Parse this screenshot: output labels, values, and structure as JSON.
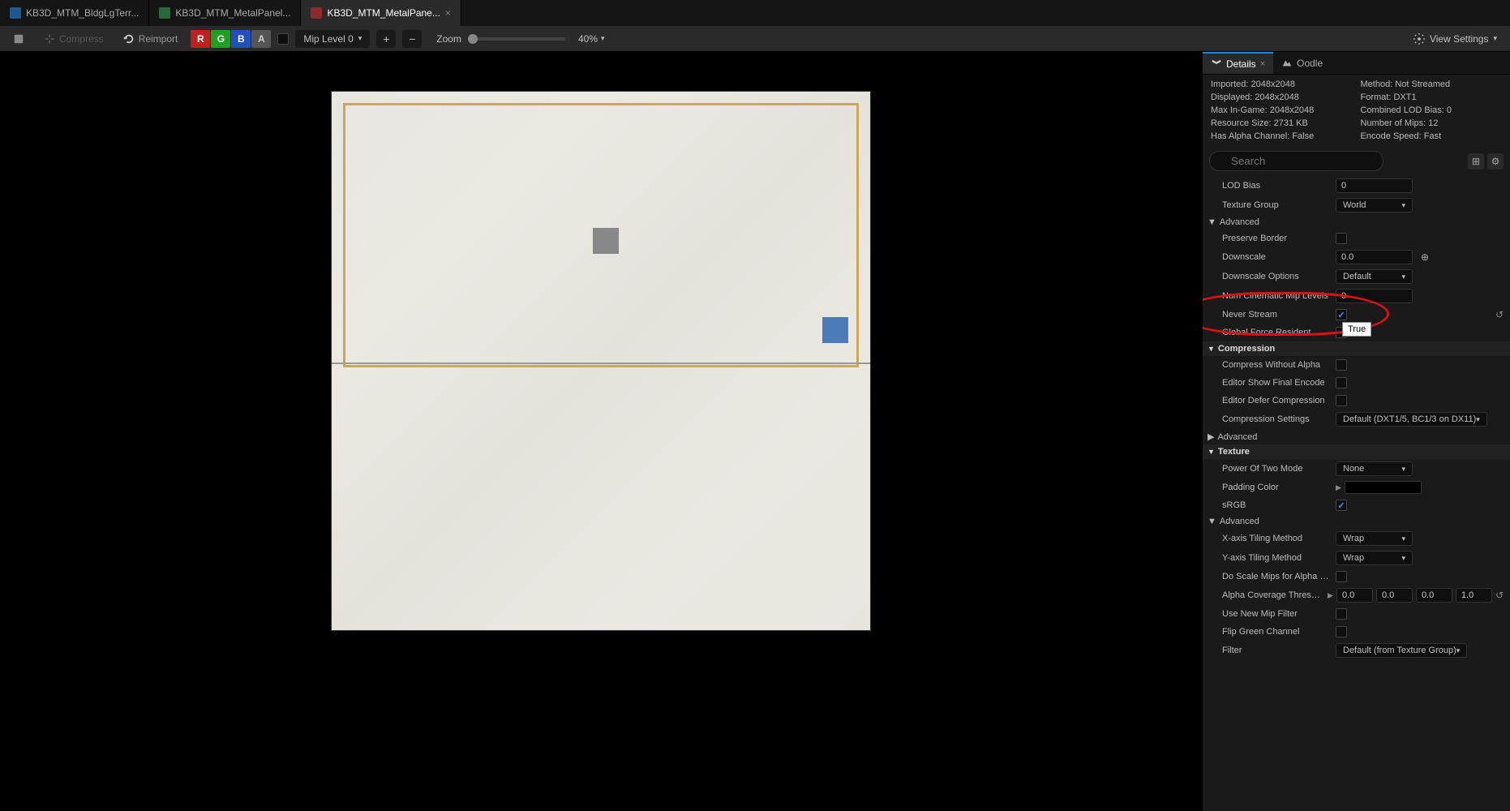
{
  "tabs": [
    {
      "label": "KB3D_MTM_BldgLgTerr...",
      "icon": "blue"
    },
    {
      "label": "KB3D_MTM_MetalPanel...",
      "icon": "green"
    },
    {
      "label": "KB3D_MTM_MetalPane...",
      "icon": "red",
      "active": true
    }
  ],
  "toolbar": {
    "compress": "Compress",
    "reimport": "Reimport",
    "r": "R",
    "g": "G",
    "b": "B",
    "a": "A",
    "mip_label": "Mip Level 0",
    "zoom_label": "Zoom",
    "zoom_value": "40%",
    "view_settings": "View Settings"
  },
  "panel_tabs": {
    "details": "Details",
    "oodle": "Oodle"
  },
  "info": {
    "imported": "Imported: 2048x2048",
    "method": "Method: Not Streamed",
    "displayed": "Displayed: 2048x2048",
    "format": "Format: DXT1",
    "max_ingame": "Max In-Game: 2048x2048",
    "combined_lod": "Combined LOD Bias: 0",
    "resource_size": "Resource Size: 2731 KB",
    "num_mips": "Number of Mips: 12",
    "has_alpha": "Has Alpha Channel: False",
    "encode_speed": "Encode Speed: Fast"
  },
  "search_placeholder": "Search",
  "props": {
    "lod_bias": {
      "label": "LOD Bias",
      "value": "0"
    },
    "texture_group": {
      "label": "Texture Group",
      "value": "World"
    },
    "advanced1": "Advanced",
    "preserve_border": {
      "label": "Preserve Border"
    },
    "downscale": {
      "label": "Downscale",
      "value": "0.0"
    },
    "downscale_options": {
      "label": "Downscale Options",
      "value": "Default"
    },
    "num_cinematic": {
      "label": "Num Cinematic Mip Levels",
      "value": "0"
    },
    "never_stream": {
      "label": "Never Stream"
    },
    "global_force": {
      "label": "Global Force Resident Mip Le..."
    },
    "compression_header": "Compression",
    "compress_wo_alpha": {
      "label": "Compress Without Alpha"
    },
    "editor_show_final": {
      "label": "Editor Show Final Encode"
    },
    "editor_defer": {
      "label": "Editor Defer Compression"
    },
    "compression_settings": {
      "label": "Compression Settings",
      "value": "Default (DXT1/5, BC1/3 on DX11)"
    },
    "advanced2": "Advanced",
    "texture_header": "Texture",
    "power_of_two": {
      "label": "Power Of Two Mode",
      "value": "None"
    },
    "padding_color": {
      "label": "Padding Color"
    },
    "srgb": {
      "label": "sRGB"
    },
    "advanced3": "Advanced",
    "x_tiling": {
      "label": "X-axis Tiling Method",
      "value": "Wrap"
    },
    "y_tiling": {
      "label": "Y-axis Tiling Method",
      "value": "Wrap"
    },
    "do_scale_mips": {
      "label": "Do Scale Mips for Alpha Cove..."
    },
    "alpha_coverage": {
      "label": "Alpha Coverage Thresholds",
      "v0": "0.0",
      "v1": "0.0",
      "v2": "0.0",
      "v3": "1.0"
    },
    "use_new_mip": {
      "label": "Use New Mip Filter"
    },
    "flip_green": {
      "label": "Flip Green Channel"
    },
    "filter": {
      "label": "Filter",
      "value": "Default (from Texture Group)"
    }
  },
  "tooltip": "True"
}
